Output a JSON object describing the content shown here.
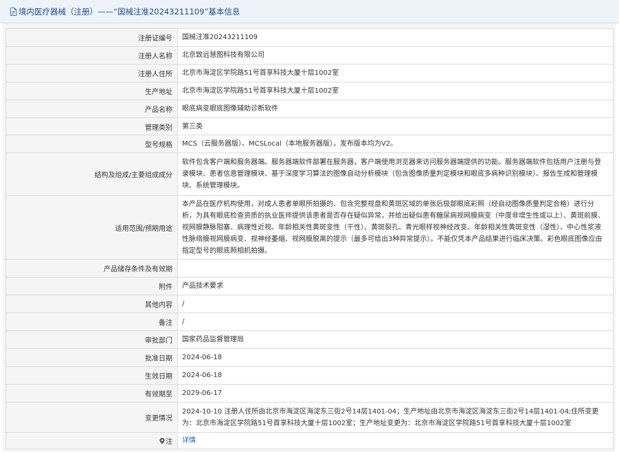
{
  "header": {
    "title": "境内医疗器械（注册）——“国械注准20243211109”基本信息",
    "icon": "document-icon"
  },
  "rows": [
    {
      "label": "注册证编号",
      "value": "国械注准20243211109"
    },
    {
      "label": "注册人名称",
      "value": "北京致远慧图科技有限公司"
    },
    {
      "label": "注册人住所",
      "value": "北京市海淀区学院路51号首享科技大厦十层1002室"
    },
    {
      "label": "生产地址",
      "value": "北京市海淀区学院路51号首享科技大厦十层1002室"
    },
    {
      "label": "产品名称",
      "value": "眼底病变眼底图像辅助诊断软件"
    },
    {
      "label": "管理类别",
      "value": "第三类"
    },
    {
      "label": "型号规格",
      "value": "MCS（云服务器版）、MCSLocal（本地服务器版），发布版本均为V2。"
    },
    {
      "label": "结构及组成/主要组成成分",
      "value": "软件包含客户端和服务器端。服务器端软件部署在服务器，客户端使用浏览器来访问服务器端提供的功能。服务器端软件包括用户注册与登录模块、患者信息管理模块、基于深度学习算法的图像自动分析模块（包含图像质量判定模块和眼底多病种识别模块）、报告生成和管理模块、系统管理模块。"
    },
    {
      "label": "适用范围/预期用途",
      "value": "本产品在医疗机构使用，对成人患者单眼所拍摄的、包含完整视盘和黄斑区域的单张后极部眼底彩照（经自动图像质量判定合格）进行分析，为具有眼底检查资质的执业医师提供该患者是否存在疑似异常，并给出疑似患有糖尿病视网膜病变（中度非增生性或以上）、黄斑前膜、视网膜静脉阻塞、病理性近视、年龄相关性黄斑变性（干性）、黄斑裂孔、青光眼样视神经改变、年龄相关性黄斑变性（湿性）、中心性浆液性脉络膜视网膜病变、视神经萎缩、视网膜脱离的提示（最多可给出3种异常提示）。不能仅凭本产品结果进行临床决策。彩色眼底图像应由指定型号的眼底照相机拍摄。"
    },
    {
      "label": "产品储存条件及有效期",
      "value": ""
    },
    {
      "label": "附件",
      "value": "产品技术要求"
    },
    {
      "label": "其他内容",
      "value": "/"
    },
    {
      "label": "备注",
      "value": "/"
    },
    {
      "label": "审批部门",
      "value": "国家药品监督管理局"
    },
    {
      "label": "批准日期",
      "value": "2024-06-18"
    },
    {
      "label": "生效日期",
      "value": "2024-06-18"
    },
    {
      "label": "有效期至",
      "value": "2029-06-17"
    },
    {
      "label": "变更情况",
      "value": "2024-10-10 注册人住所由北京市海淀区海淀东三街2号14层1401-04；生产地址由北京市海淀区海淀东三街2号14层1401-04;住所变更为：北京市海淀区学院路51号首享科技大厦十层1002室；生产地址变更为：北京市海淀区学院路51号首享科技大厦十层1002室"
    }
  ],
  "note_row": {
    "label": "注",
    "link_text": "详情",
    "icon": "pin-icon"
  }
}
